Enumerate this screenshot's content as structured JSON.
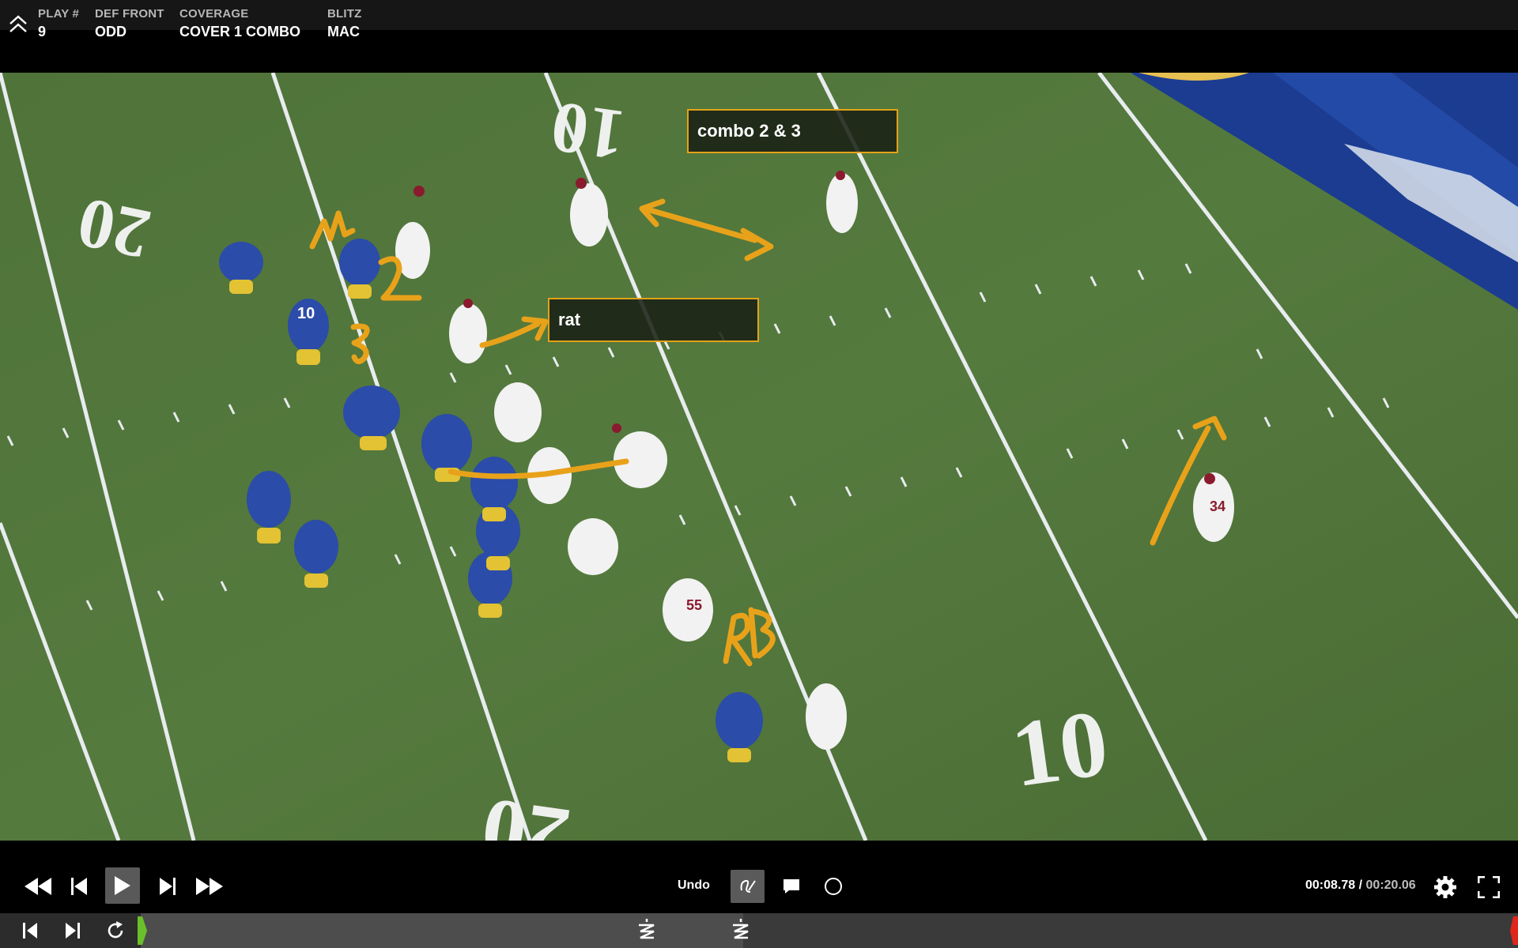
{
  "header": {
    "play_label": "PLAY #",
    "play_value": "9",
    "def_front_label": "DEF FRONT",
    "def_front_value": "ODD",
    "coverage_label": "COVERAGE",
    "coverage_value": "COVER 1 COMBO",
    "blitz_label": "BLITZ",
    "blitz_value": "MAC"
  },
  "video": {
    "field_numbers": [
      "10",
      "20",
      "10",
      "20",
      "10"
    ],
    "jersey_numbers": [
      "10",
      "34",
      "55"
    ],
    "annotations": {
      "combo_note": "combo 2 & 3",
      "rat_note": "rat",
      "handwritten": [
        "1",
        "2",
        "3",
        "RB"
      ]
    }
  },
  "controls": {
    "undo_label": "Undo",
    "current_time": "00:08.78",
    "separator": " / ",
    "duration": "00:20.06",
    "progress_fraction": 0.4377,
    "icons": [
      "rewind-icon",
      "step-back-icon",
      "play-icon",
      "step-forward-icon",
      "fast-forward-icon",
      "pen-tool-icon",
      "comment-icon",
      "circle-tool-icon",
      "settings-icon",
      "fullscreen-icon",
      "skip-start-icon",
      "skip-end-icon",
      "repeat-icon",
      "marker-icon"
    ]
  },
  "colors": {
    "annotation": "#e8a21a",
    "field": "#4d7038",
    "track_start": "#6bbf2a",
    "track_end": "#e0251b"
  }
}
